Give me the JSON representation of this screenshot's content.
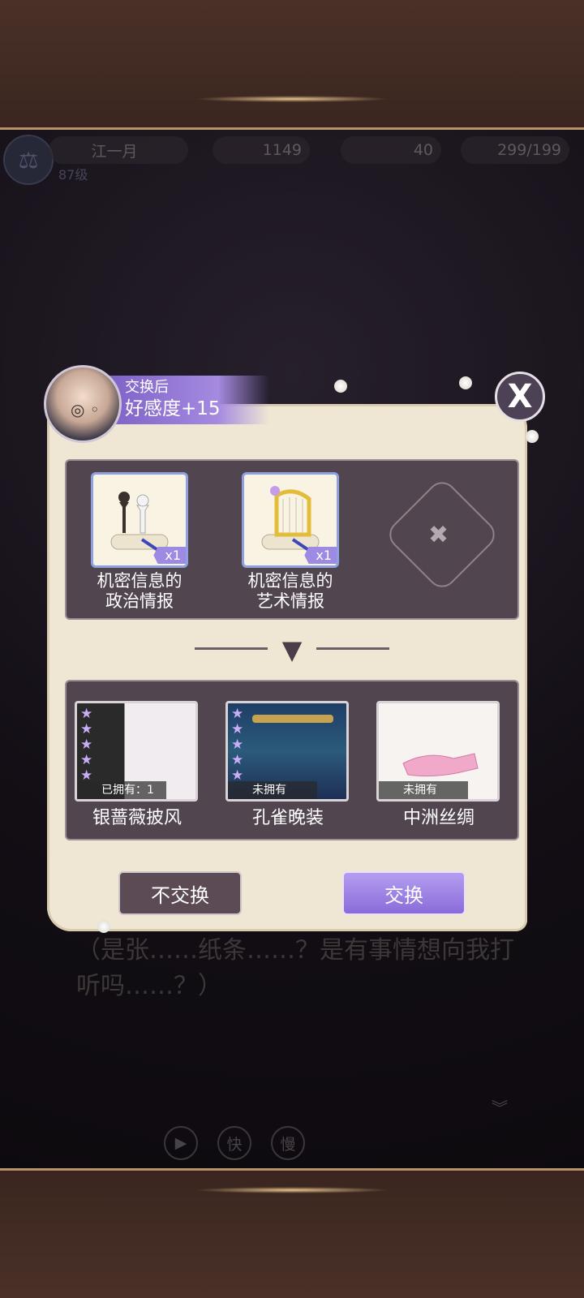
{
  "hud": {
    "player_name": "江一月",
    "level": "87级",
    "gold": "1149",
    "gems": "40",
    "stamina": "299/199"
  },
  "dialog": {
    "text": "（是张……纸条……？是有事情想向我打听吗……？）"
  },
  "controls": {
    "fast": "快",
    "slow": "慢"
  },
  "exchange": {
    "tag_small": "交换后",
    "tag_large": "好感度+15",
    "close_label": "X",
    "inputs": [
      {
        "name_line1": "机密信息的",
        "name_line2": "政治情报",
        "qty": "x1"
      },
      {
        "name_line1": "机密信息的",
        "name_line2": "艺术情报",
        "qty": "x1"
      }
    ],
    "rewards": [
      {
        "name": "银蔷薇披风",
        "status": "已拥有：1",
        "stars": 5
      },
      {
        "name": "孔雀晚装",
        "status": "未拥有",
        "stars": 5
      },
      {
        "name": "中洲丝绸",
        "status": "未拥有",
        "stars": 0
      }
    ],
    "cancel_label": "不交换",
    "confirm_label": "交换"
  },
  "colors": {
    "accent": "#8a6bd9",
    "panel": "#efe7d3",
    "box": "#514550"
  }
}
